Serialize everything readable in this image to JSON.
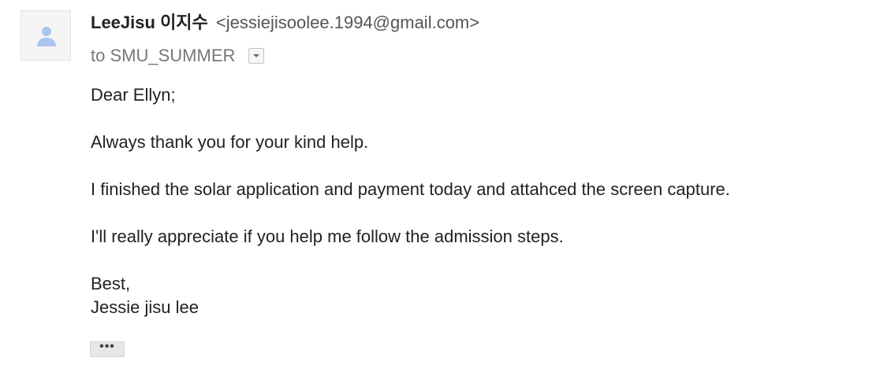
{
  "message": {
    "sender": {
      "name": "LeeJisu",
      "name_korean": "이지수",
      "email": "<jessiejisoolee.1994@gmail.com>",
      "avatar_icon": "person-icon"
    },
    "recipients": {
      "prefix": "to",
      "name": "SMU_SUMMER",
      "details_icon": "chevron-down-icon"
    },
    "body": {
      "greeting": "Dear Ellyn;",
      "paragraphs": [
        "Always thank you for your kind help.",
        "I finished the solar application and payment today and attahced the screen capture.",
        "I'll really appreciate if you help me follow the admission steps."
      ],
      "closing": "Best,",
      "signature": "Jessie jisu lee"
    },
    "trimmed_content_label": "•••"
  },
  "colors": {
    "avatar_bg": "#f5f5f5",
    "avatar_icon": "#aac4f0",
    "text": "#222222",
    "muted": "#777777"
  }
}
